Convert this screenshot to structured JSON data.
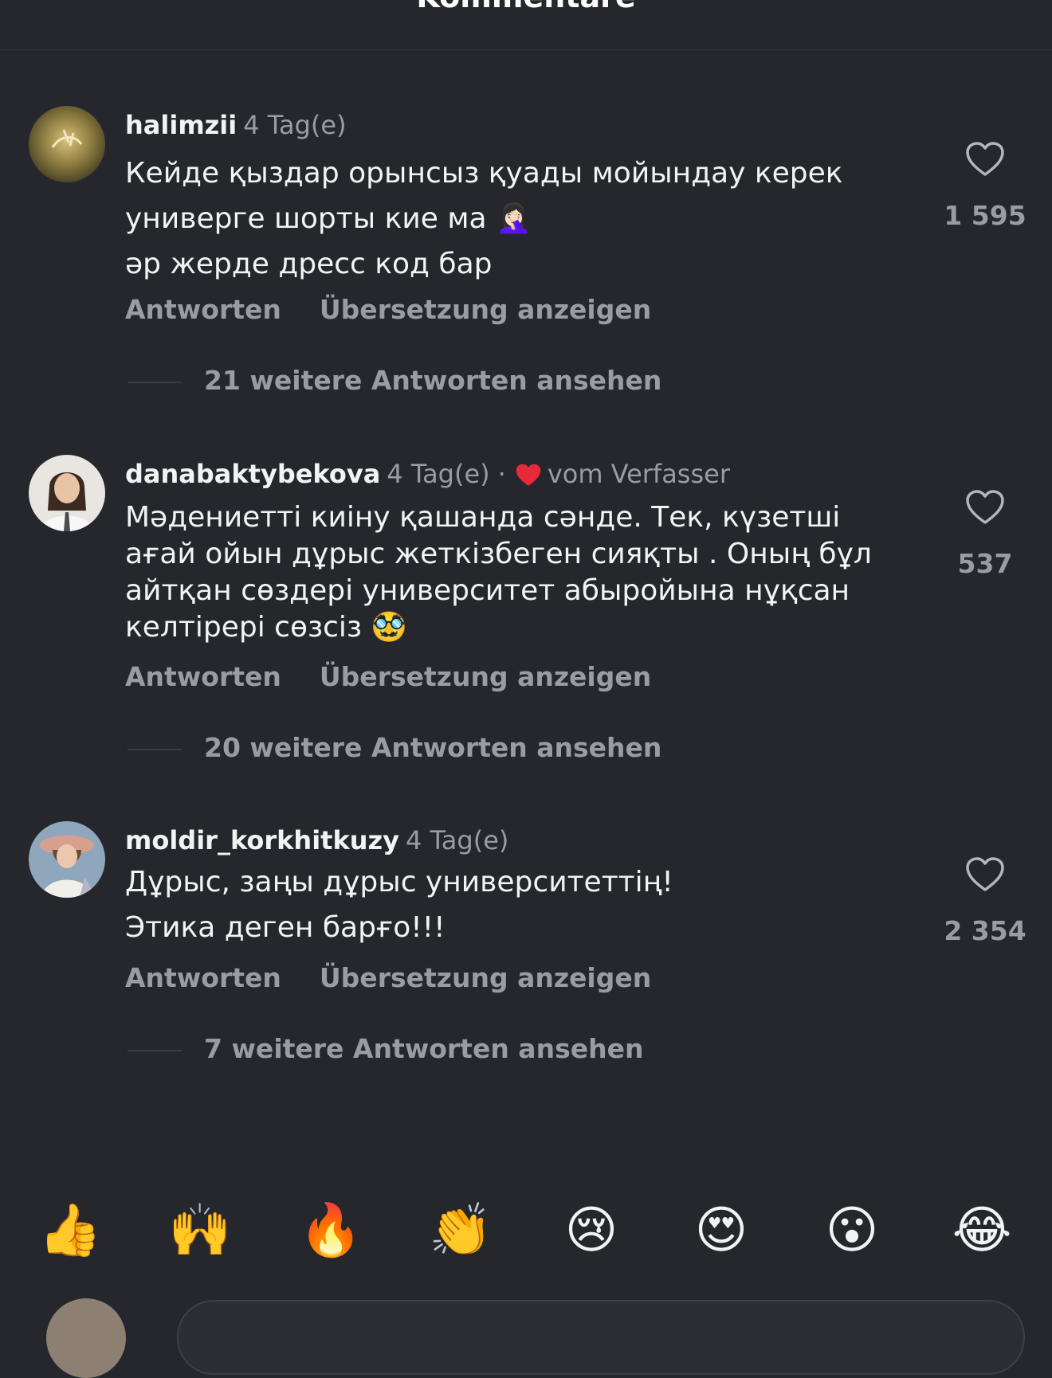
{
  "header": {
    "title": "Kommentare"
  },
  "comments": [
    {
      "username": "halimzii",
      "time": "4 Tag(e)",
      "lines": [
        "Кейде қыздар орынсыз қуады мойындау керек",
        "универге шорты кие ма",
        "әр жерде дресс код бар"
      ],
      "line_emoji": "🤦🏻‍♀️",
      "reply_label": "Antworten",
      "translate_label": "Übersetzung anzeigen",
      "more_replies": "21 weitere Antworten ansehen",
      "likes": "1 595",
      "like_icon": "heart-outline-icon"
    },
    {
      "username": "danabaktybekova",
      "time": "4 Tag(e)",
      "separator": "·",
      "author_liked": "vom Verfasser",
      "author_heart_color": "#e8293b",
      "lines": [
        "Мәдениетті киіну қашанда сәнде. Тек, күзетші",
        "ағай ойын дұрыс жеткізбеген сияқты . Оның бұл",
        "айтқан сөздері университет абыройына нұқсан",
        "келтірері сөзсіз"
      ],
      "line_emoji": "🥸",
      "reply_label": "Antworten",
      "translate_label": "Übersetzung anzeigen",
      "more_replies": "20 weitere Antworten ansehen",
      "likes": "537",
      "like_icon": "heart-outline-icon"
    },
    {
      "username": "moldir_korkhitkuzy",
      "time": "4 Tag(e)",
      "lines": [
        "Дұрыс, заңы дұрыс университеттің!",
        "Этика деген барғо!!!"
      ],
      "reply_label": "Antworten",
      "translate_label": "Übersetzung anzeigen",
      "more_replies": "7 weitere Antworten ansehen",
      "likes": "2 354",
      "like_icon": "heart-outline-icon"
    }
  ],
  "reactions": [
    "👍",
    "🙌",
    "🔥",
    "👏",
    "😢",
    "😍",
    "😮",
    "😂"
  ],
  "colors": {
    "background": "#25272c",
    "text": "#f2f3f5",
    "muted": "#9a9ca3"
  }
}
